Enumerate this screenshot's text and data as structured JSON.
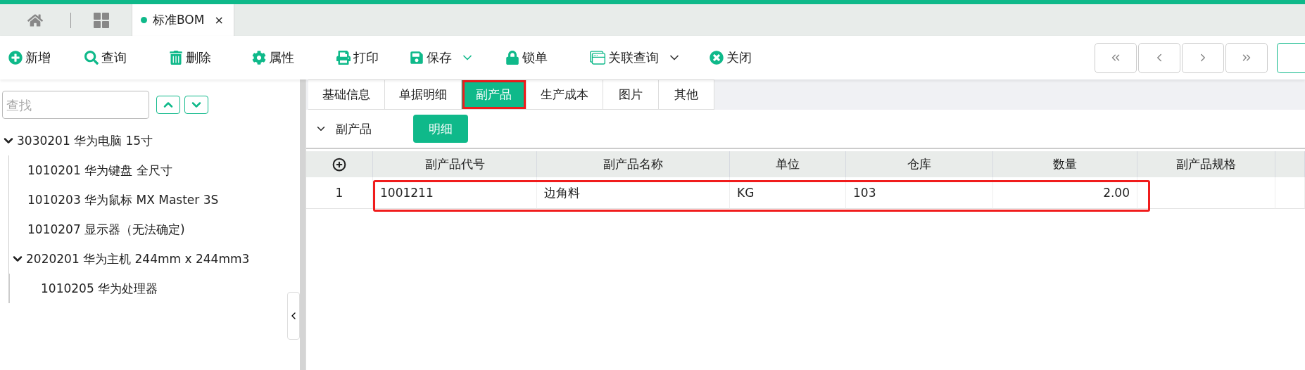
{
  "tabs": [
    {
      "label": "标准BOM",
      "selected": true,
      "close": "×"
    }
  ],
  "toolbar": [
    {
      "label": "新增",
      "dropdown": false
    },
    {
      "label": "查询",
      "dropdown": false
    },
    {
      "label": "删除",
      "dropdown": false
    },
    {
      "label": "属性",
      "dropdown": false
    },
    {
      "label": "打印",
      "dropdown": false
    },
    {
      "label": "保存",
      "dropdown": true
    },
    {
      "label": "锁单",
      "dropdown": false
    },
    {
      "label": "关联查询",
      "dropdown": true
    },
    {
      "label": "关闭",
      "dropdown": false
    }
  ],
  "search": {
    "placeholder": "查找"
  },
  "tree": [
    {
      "label": "3030201 华为电脑 15寸",
      "expanded": true,
      "children": [
        {
          "label": "1010201 华为键盘 全尺寸"
        },
        {
          "label": "1010203 华为鼠标 MX Master 3S"
        },
        {
          "label": "1010207 显示器（无法确定)"
        },
        {
          "label": "2020201 华为主机 244mm x 244mm3",
          "expanded": true,
          "children": [
            {
              "label": "1010205 华为处理器"
            }
          ]
        }
      ]
    }
  ],
  "detail_tabs": [
    {
      "label": "基础信息",
      "selected": false,
      "highlighted": false
    },
    {
      "label": "单据明细",
      "selected": false,
      "highlighted": false
    },
    {
      "label": "副产品",
      "selected": true,
      "highlighted": true
    },
    {
      "label": "生产成本",
      "selected": false,
      "highlighted": false
    },
    {
      "label": "图片",
      "selected": false,
      "highlighted": false
    },
    {
      "label": "其他",
      "selected": false,
      "highlighted": false
    }
  ],
  "section": {
    "title": "副产品",
    "expanded": true,
    "button": "明细"
  },
  "table": {
    "columns": [
      {
        "label": "副产品代号",
        "kind": "text"
      },
      {
        "label": "副产品名称",
        "kind": "text"
      },
      {
        "label": "单位",
        "kind": "text"
      },
      {
        "label": "仓库",
        "kind": "text"
      },
      {
        "label": "数量",
        "kind": "number"
      },
      {
        "label": "副产品规格",
        "kind": "text"
      }
    ],
    "rows": [
      {
        "index": "1",
        "highlighted": true,
        "cells": [
          "1001211",
          "边角料",
          "KG",
          "103",
          "2.00"
        ]
      }
    ]
  }
}
